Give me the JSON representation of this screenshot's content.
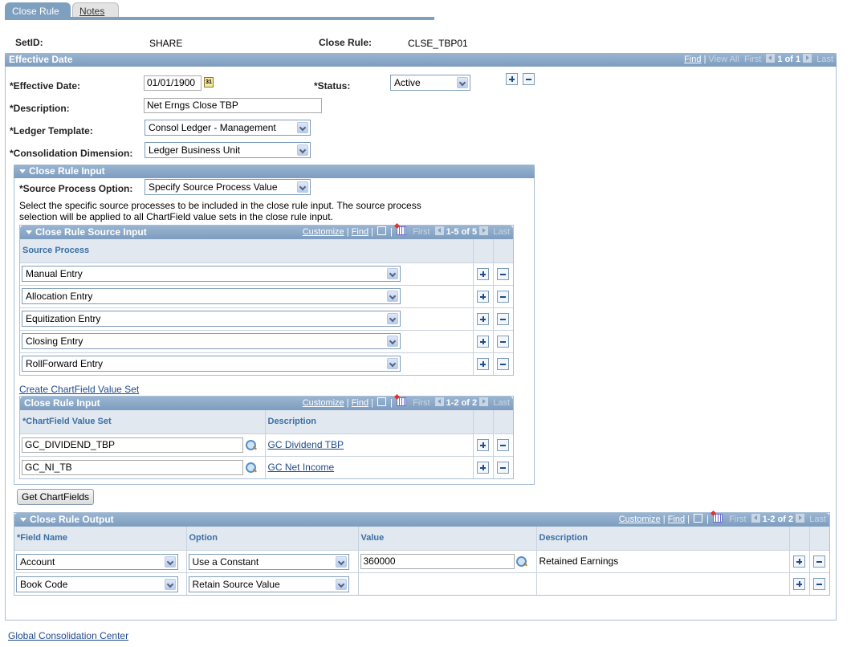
{
  "tabs": [
    {
      "label": "Close Rule",
      "active": true
    },
    {
      "label": "Notes",
      "active": false
    }
  ],
  "header": {
    "setid_label": "SetID:",
    "setid_value": "SHARE",
    "close_rule_label": "Close Rule:",
    "close_rule_value": "CLSE_TBP01"
  },
  "effective_date_section": {
    "title": "Effective Date",
    "nav": {
      "find": "Find",
      "sep": "|",
      "view_all": "View All",
      "first": "First",
      "count": "1 of 1",
      "last": "Last"
    },
    "fields": {
      "effective_date_label": "*Effective Date:",
      "effective_date_value": "01/01/1900",
      "calendar_icon_text": "31",
      "status_label": "*Status:",
      "status_value": "Active",
      "description_label": "*Description:",
      "description_value": "Net Erngs Close TBP",
      "ledger_template_label": "*Ledger Template:",
      "ledger_template_value": "Consol Ledger - Management",
      "consolidation_dimension_label": "*Consolidation Dimension:",
      "consolidation_dimension_value": "Ledger Business Unit"
    }
  },
  "close_rule_input": {
    "title": "Close Rule Input",
    "source_process_option_label": "*Source Process Option:",
    "source_process_option_value": "Specify Source Process Value",
    "instructions": "Select the specific source processes to be included in the close rule input. The source process selection will be applied to all ChartField value sets in the close rule input.",
    "source_grid": {
      "title": "Close Rule Source Input",
      "nav": {
        "customize": "Customize",
        "find": "Find",
        "first": "First",
        "count": "1-5 of 5",
        "last": "Last"
      },
      "column": "Source Process",
      "rows": [
        "Manual Entry",
        "Allocation Entry",
        "Equitization Entry",
        "Closing Entry",
        "RollForward Entry"
      ]
    },
    "create_link": "Create ChartField Value Set",
    "value_set_grid": {
      "title": "Close Rule Input",
      "nav": {
        "customize": "Customize",
        "find": "Find",
        "first": "First",
        "count": "1-2 of 2",
        "last": "Last"
      },
      "columns": [
        "*ChartField Value Set",
        "Description"
      ],
      "rows": [
        {
          "value_set": "GC_DIVIDEND_TBP",
          "description": "GC Dividend TBP"
        },
        {
          "value_set": "GC_NI_TB",
          "description": "GC Net Income"
        }
      ]
    }
  },
  "get_chartfields_button": "Get ChartFields",
  "close_rule_output": {
    "title": "Close Rule Output",
    "nav": {
      "customize": "Customize",
      "find": "Find",
      "first": "First",
      "count": "1-2 of 2",
      "last": "Last"
    },
    "columns": [
      "*Field Name",
      "Option",
      "Value",
      "Description"
    ],
    "rows": [
      {
        "field_name": "Account",
        "option": "Use a Constant",
        "value": "360000",
        "description": "Retained Earnings"
      },
      {
        "field_name": "Book Code",
        "option": "Retain Source Value",
        "value": "",
        "description": ""
      }
    ]
  },
  "footer_link": "Global Consolidation Center"
}
